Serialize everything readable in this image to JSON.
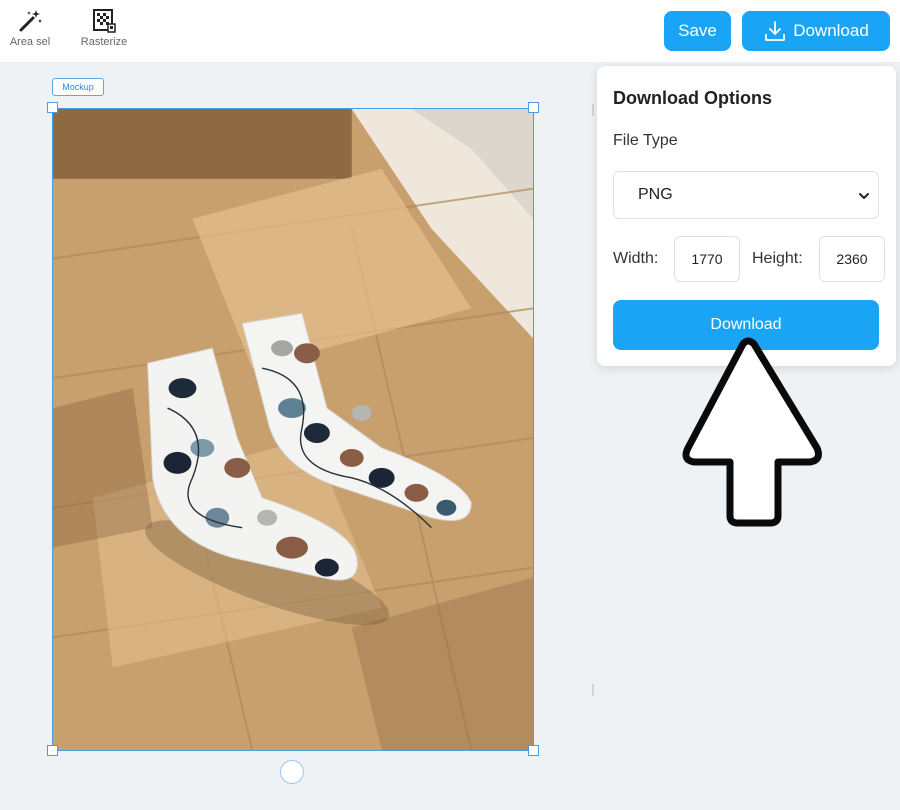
{
  "toolbar": {
    "tools": [
      {
        "label": "Area sel",
        "icon": "magic-wand-icon"
      },
      {
        "label": "Rasterize",
        "icon": "rasterize-icon"
      }
    ],
    "save_label": "Save",
    "download_label": "Download",
    "download_icon": "download-icon"
  },
  "canvas": {
    "layer_tag": "Mockup",
    "image_description_icon": "socks-photo"
  },
  "download_panel": {
    "title": "Download Options",
    "file_type_label": "File Type",
    "file_type_value": "PNG",
    "width_label": "Width:",
    "width_value": "1770",
    "height_label": "Height:",
    "height_value": "2360",
    "download_label": "Download"
  },
  "colors": {
    "accent": "#19a4f5",
    "workspace_bg": "#eef2f4",
    "selection": "#4c9be6"
  }
}
